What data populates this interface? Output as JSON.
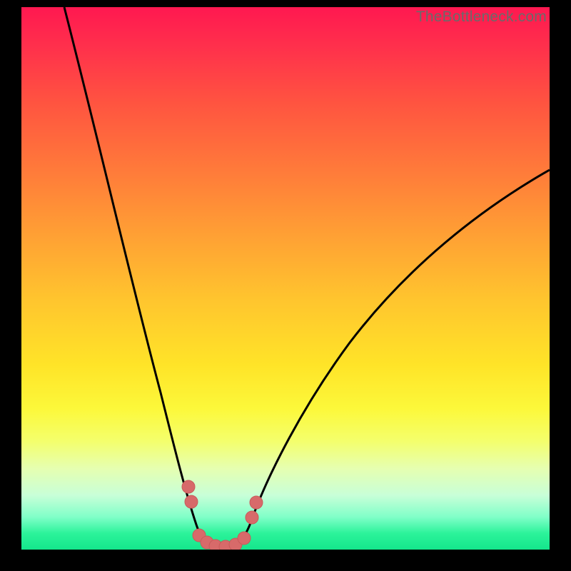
{
  "watermark": "TheBottleneck.com",
  "chart_data": {
    "type": "line",
    "title": "",
    "xlabel": "",
    "ylabel": "",
    "xlim": [
      0,
      100
    ],
    "ylim": [
      0,
      100
    ],
    "grid": false,
    "legend": false,
    "background_gradient": "red-yellow-green (top-to-bottom)",
    "note": "No axes, ticks, or numeric labels are visible; values are estimated from pixel positions on a 0-100 normalized grid. y=0 is the bottom green band, y=100 is the top red band.",
    "series": [
      {
        "name": "left-branch",
        "path_estimate": [
          {
            "x": 8,
            "y": 100
          },
          {
            "x": 12,
            "y": 86
          },
          {
            "x": 16,
            "y": 72
          },
          {
            "x": 20,
            "y": 57
          },
          {
            "x": 24,
            "y": 42
          },
          {
            "x": 27,
            "y": 30
          },
          {
            "x": 29,
            "y": 22
          },
          {
            "x": 31,
            "y": 14
          },
          {
            "x": 33,
            "y": 6
          },
          {
            "x": 35,
            "y": 1
          },
          {
            "x": 39,
            "y": 0
          }
        ]
      },
      {
        "name": "right-branch",
        "path_estimate": [
          {
            "x": 39,
            "y": 0
          },
          {
            "x": 42,
            "y": 1
          },
          {
            "x": 44,
            "y": 5
          },
          {
            "x": 47,
            "y": 12
          },
          {
            "x": 52,
            "y": 22
          },
          {
            "x": 58,
            "y": 32
          },
          {
            "x": 66,
            "y": 42
          },
          {
            "x": 74,
            "y": 50
          },
          {
            "x": 82,
            "y": 57
          },
          {
            "x": 90,
            "y": 63
          },
          {
            "x": 100,
            "y": 70
          }
        ]
      },
      {
        "name": "valley-marker-dots",
        "type_hint": "scatter",
        "color": "#d76a6a",
        "points_estimate": [
          {
            "x": 31.5,
            "y": 12
          },
          {
            "x": 32.0,
            "y": 9
          },
          {
            "x": 33.5,
            "y": 2.0
          },
          {
            "x": 35.0,
            "y": 1.0
          },
          {
            "x": 36.5,
            "y": 0.5
          },
          {
            "x": 38.5,
            "y": 0.5
          },
          {
            "x": 40.5,
            "y": 0.8
          },
          {
            "x": 42.0,
            "y": 2.0
          },
          {
            "x": 43.5,
            "y": 6
          },
          {
            "x": 44.2,
            "y": 9
          }
        ]
      }
    ]
  }
}
